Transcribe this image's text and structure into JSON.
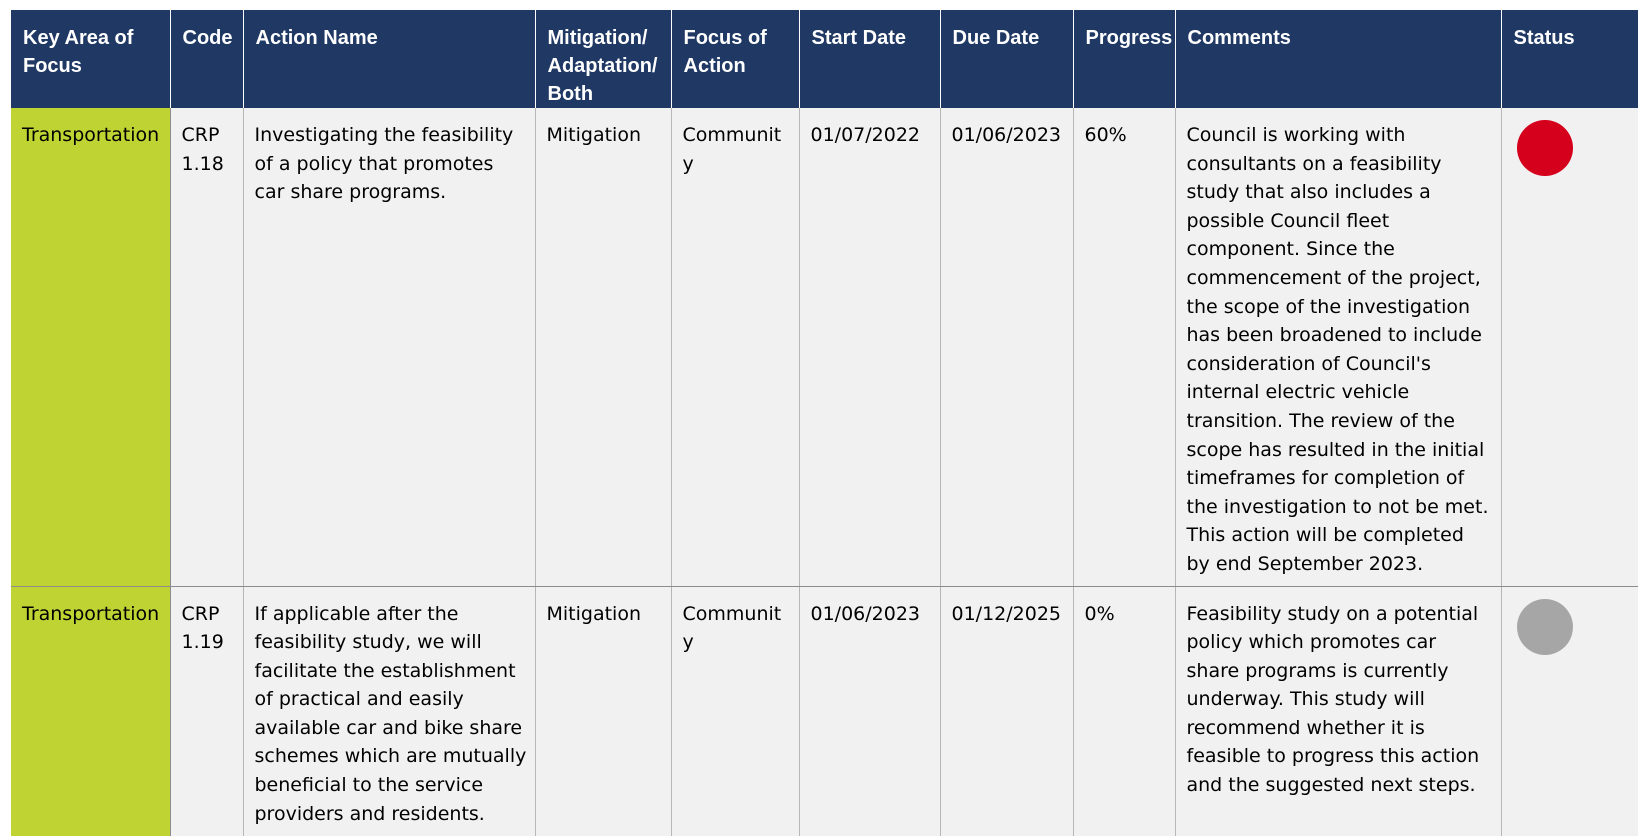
{
  "columns": {
    "key_area": "Key Area of Focus",
    "code": "Code",
    "action_name": "Action Name",
    "mitigation": "Mitigation/ Adaptation/ Both",
    "focus": "Focus of Action",
    "start": "Start Date",
    "due": "Due Date",
    "progress": "Progress",
    "comments": "Comments",
    "status": "Status"
  },
  "rows": [
    {
      "key_area": "Transportation",
      "code": "CRP 1.18",
      "action_name": "Investigating the feasibility of a policy that promotes car share programs.",
      "mitigation": "Mitigation",
      "focus": "Community",
      "start": "01/07/2022",
      "due": "01/06/2023",
      "progress": "60%",
      "comments": "Council is working with consultants on a feasibility study that also includes a possible Council fleet component. Since the commencement of the project, the scope of the investigation has been broadened to include consideration of Council's internal electric vehicle transition. The review of the scope has resulted in the initial timeframes for completion of the investigation to not be met. This action will be completed by end September 2023.",
      "status_color": "#d5001c"
    },
    {
      "key_area": "Transportation",
      "code": "CRP 1.19",
      "action_name": "If applicable after the feasibility study, we will facilitate the establishment of practical and easily available car and bike share schemes which are mutually beneficial to the service providers and residents.",
      "mitigation": "Mitigation",
      "focus": "Community",
      "start": "01/06/2023",
      "due": "01/12/2025",
      "progress": "0%",
      "comments": "Feasibility study on a potential policy which promotes car share programs is currently underway. This study will recommend whether it is feasible to progress this action and the suggested next steps.",
      "status_color": "#a6a6a6"
    }
  ],
  "colors": {
    "header_bg": "#1f3864",
    "area_bg": "#bfd433",
    "cell_bg": "#f2f1f2"
  }
}
